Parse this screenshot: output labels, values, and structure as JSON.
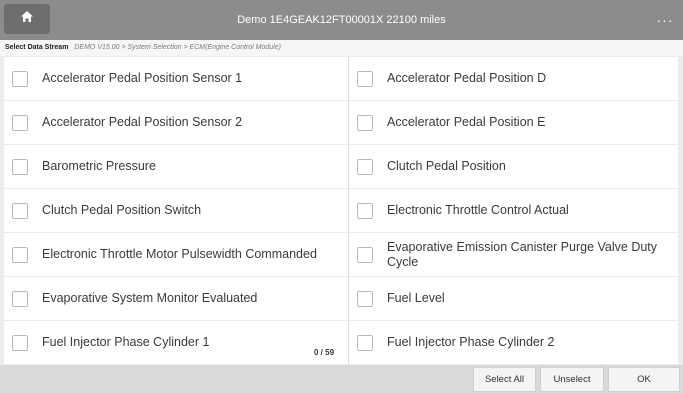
{
  "title_bar": {
    "title": "Demo  1E4GEAK12FT00001X  22100 miles",
    "more": "···"
  },
  "breadcrumb": {
    "label": "Select Data Stream",
    "path": "DEMO V15.00 > System Selection > ECM(Engine Control Module)"
  },
  "items": [
    {
      "label": "Accelerator Pedal Position Sensor 1",
      "checked": false
    },
    {
      "label": "Accelerator Pedal Position D",
      "checked": false
    },
    {
      "label": "Accelerator Pedal Position Sensor 2",
      "checked": false
    },
    {
      "label": "Accelerator Pedal Position E",
      "checked": false
    },
    {
      "label": "Barometric Pressure",
      "checked": false
    },
    {
      "label": "Clutch Pedal Position",
      "checked": false
    },
    {
      "label": "Clutch Pedal Position Switch",
      "checked": false
    },
    {
      "label": "Electronic Throttle Control Actual",
      "checked": false
    },
    {
      "label": "Electronic Throttle Motor Pulsewidth Commanded",
      "checked": false
    },
    {
      "label": "Evaporative Emission Canister Purge Valve Duty Cycle",
      "checked": false
    },
    {
      "label": "Evaporative System Monitor Evaluated",
      "checked": false
    },
    {
      "label": "Fuel Level",
      "checked": false
    },
    {
      "label": "Fuel Injector Phase Cylinder 1",
      "checked": false
    },
    {
      "label": "Fuel Injector Phase Cylinder 2",
      "checked": false
    }
  ],
  "counter": "0 / 59",
  "buttons": {
    "select_all": "Select All",
    "unselect": "Unselect",
    "ok": "OK"
  },
  "colors": {
    "title_bar": "#8c8c8c",
    "home_button": "#6e6e6e",
    "bottom_bar": "#d9d9d9"
  },
  "icons": {
    "home": "home-icon",
    "more": "more-icon"
  }
}
